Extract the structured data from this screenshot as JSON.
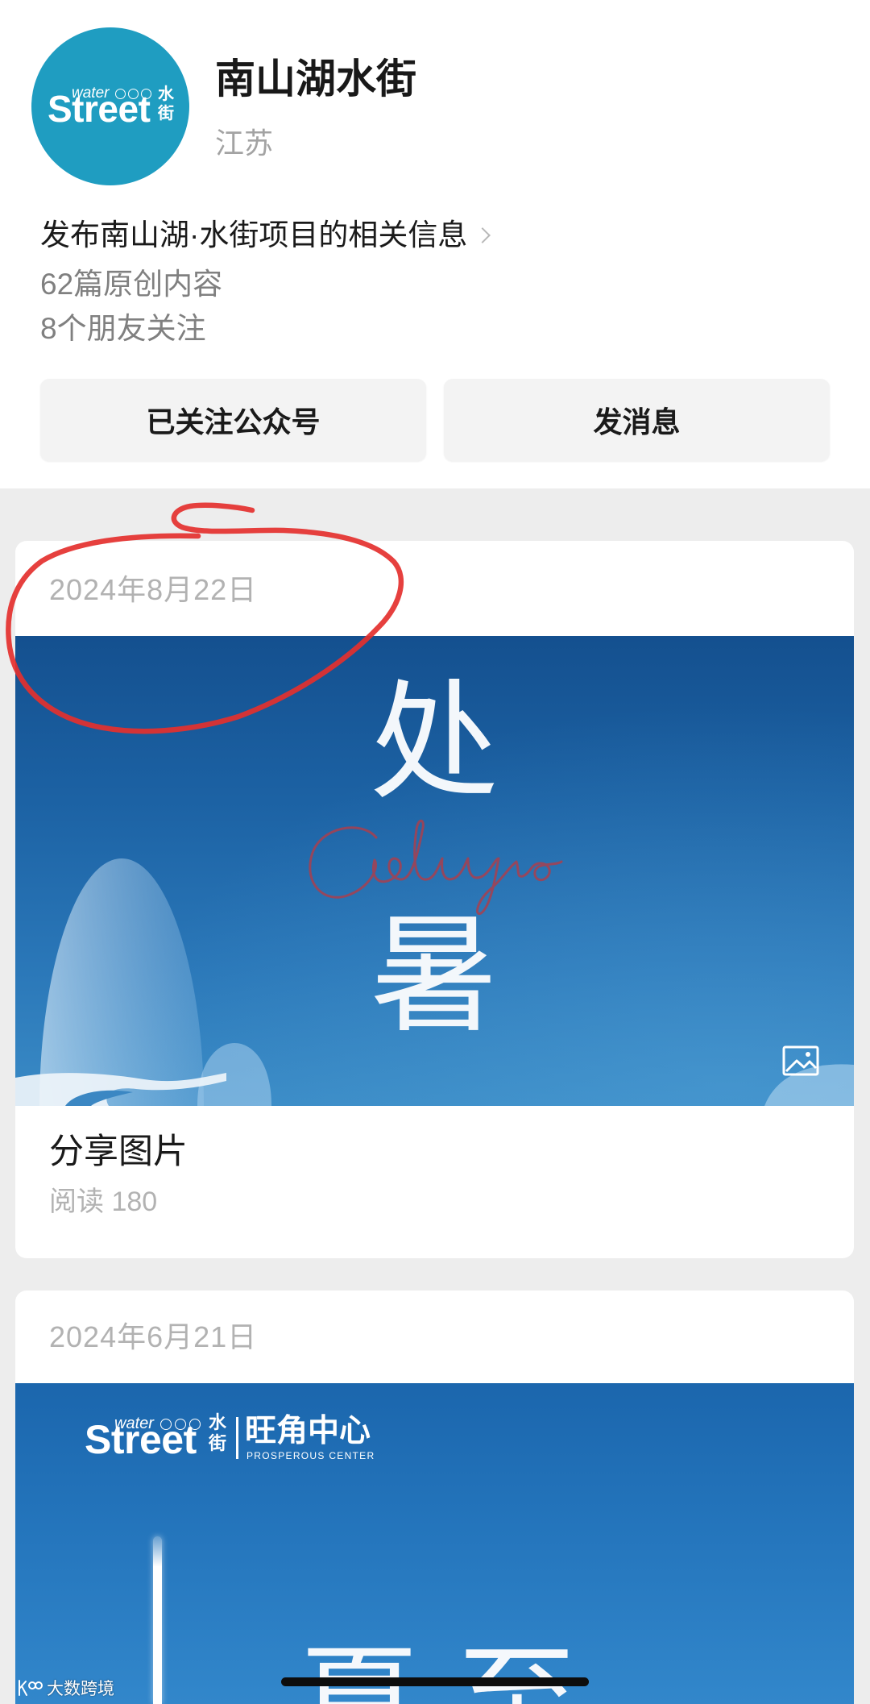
{
  "account": {
    "avatar_logo": {
      "small": "water",
      "main": "Street",
      "cn_top": "水",
      "cn_bottom": "街"
    },
    "name": "南山湖水街",
    "region": "江苏",
    "description": "发布南山湖·水街项目的相关信息",
    "original_count": "62篇原创内容",
    "friends_following": "8个朋友关注"
  },
  "actions": {
    "follow_label": "已关注公众号",
    "message_label": "发消息"
  },
  "posts": [
    {
      "date": "2024年8月22日",
      "cover": {
        "char_top": "处",
        "char_bottom": "暑"
      },
      "title": "分享图片",
      "reads": "阅读 180"
    },
    {
      "date": "2024年6月21日",
      "cover": {
        "logo_small": "water",
        "logo_main": "Street",
        "logo_cn_top": "水",
        "logo_cn_bottom": "街",
        "brand": "旺角中心",
        "brand_en": "PROSPEROUS CENTER",
        "headline": "夏至"
      }
    }
  ],
  "icons": {
    "description_chevron": "chevron-right-icon",
    "post_type": "image-icon",
    "watermark_logo": "watermark-logo-icon"
  },
  "watermark": {
    "text": "大数跨境"
  },
  "colors": {
    "avatar_bg": "#1f9dc1",
    "page_bg": "#ededed",
    "annotation_red": "#e4302e",
    "script_red": "#a8404f",
    "cover1_top": "#14508f",
    "cover1_bottom": "#3a8bc6",
    "cover2_top": "#1b66ad",
    "cover2_bottom": "#3287cb"
  }
}
